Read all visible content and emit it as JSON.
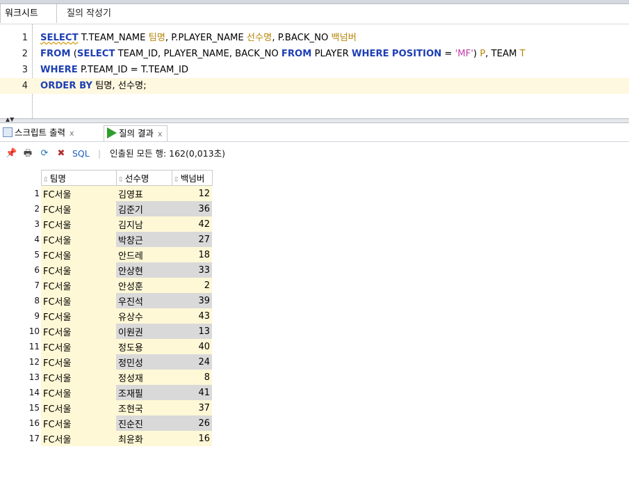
{
  "worksheet_tabs": {
    "active": "워크시트",
    "inactive": "질의 작성기"
  },
  "editor": {
    "lines": [
      {
        "num": "1",
        "parts": [
          {
            "t": "SELECT",
            "c": "kw sq"
          },
          {
            "t": " T.TEAM_NAME ",
            "c": ""
          },
          {
            "t": "팀명",
            "c": "kr"
          },
          {
            "t": ", P.PLAYER_NAME ",
            "c": ""
          },
          {
            "t": "선수명",
            "c": "kr"
          },
          {
            "t": ", P.BACK_NO ",
            "c": ""
          },
          {
            "t": "백넘버",
            "c": "kr"
          }
        ]
      },
      {
        "num": "2",
        "parts": [
          {
            "t": "FROM",
            "c": "kw"
          },
          {
            "t": " (",
            "c": ""
          },
          {
            "t": "SELECT",
            "c": "kw"
          },
          {
            "t": " TEAM_ID, PLAYER_NAME, BACK_NO ",
            "c": ""
          },
          {
            "t": "FROM",
            "c": "kw"
          },
          {
            "t": " PLAYER ",
            "c": ""
          },
          {
            "t": "WHERE",
            "c": "kw"
          },
          {
            "t": " ",
            "c": ""
          },
          {
            "t": "POSITION",
            "c": "kw"
          },
          {
            "t": " = ",
            "c": ""
          },
          {
            "t": "'MF'",
            "c": "str"
          },
          {
            "t": ") ",
            "c": ""
          },
          {
            "t": "P",
            "c": "kr"
          },
          {
            "t": ", TEAM ",
            "c": ""
          },
          {
            "t": "T",
            "c": "kr"
          }
        ]
      },
      {
        "num": "3",
        "parts": [
          {
            "t": "WHERE",
            "c": "kw"
          },
          {
            "t": " P.TEAM_ID = T.TEAM_ID",
            "c": ""
          }
        ]
      },
      {
        "num": "4",
        "parts": [
          {
            "t": "ORDER BY",
            "c": "kw"
          },
          {
            "t": " 팀명, 선수명;",
            "c": ""
          }
        ]
      }
    ]
  },
  "output_tabs": {
    "script": "스크립트 출력",
    "result": "질의 결과",
    "close": "x"
  },
  "toolbar": {
    "sql": "SQL",
    "sep": "|",
    "status": "인출된 모든 행: 162(0,013초)"
  },
  "grid": {
    "headers": [
      "팀명",
      "선수명",
      "백넘버"
    ],
    "rows": [
      {
        "n": "1",
        "team": "FC서울",
        "name": "김영표",
        "back": "12"
      },
      {
        "n": "2",
        "team": "FC서울",
        "name": "김준기",
        "back": "36"
      },
      {
        "n": "3",
        "team": "FC서울",
        "name": "김지남",
        "back": "42"
      },
      {
        "n": "4",
        "team": "FC서울",
        "name": "박창근",
        "back": "27"
      },
      {
        "n": "5",
        "team": "FC서울",
        "name": "안드레",
        "back": "18"
      },
      {
        "n": "6",
        "team": "FC서울",
        "name": "안상현",
        "back": "33"
      },
      {
        "n": "7",
        "team": "FC서울",
        "name": "안성훈",
        "back": "2"
      },
      {
        "n": "8",
        "team": "FC서울",
        "name": "우진석",
        "back": "39"
      },
      {
        "n": "9",
        "team": "FC서울",
        "name": "유상수",
        "back": "43"
      },
      {
        "n": "10",
        "team": "FC서울",
        "name": "이원권",
        "back": "13"
      },
      {
        "n": "11",
        "team": "FC서울",
        "name": "정도용",
        "back": "40"
      },
      {
        "n": "12",
        "team": "FC서울",
        "name": "정민성",
        "back": "24"
      },
      {
        "n": "13",
        "team": "FC서울",
        "name": "정성재",
        "back": "8"
      },
      {
        "n": "14",
        "team": "FC서울",
        "name": "조재필",
        "back": "41"
      },
      {
        "n": "15",
        "team": "FC서울",
        "name": "조현국",
        "back": "37"
      },
      {
        "n": "16",
        "team": "FC서울",
        "name": "진순진",
        "back": "26"
      },
      {
        "n": "17",
        "team": "FC서울",
        "name": "최윤화",
        "back": "16"
      }
    ]
  }
}
